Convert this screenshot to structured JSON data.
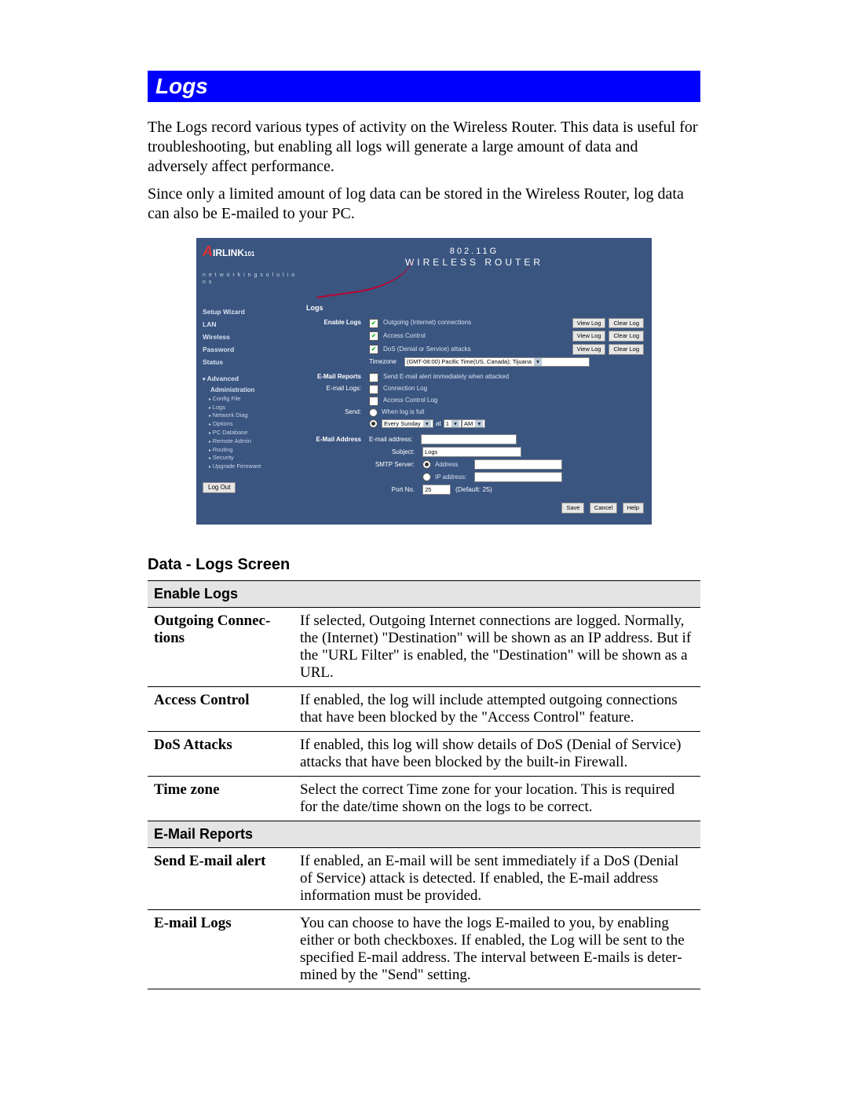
{
  "title": "Logs",
  "para1": "The Logs record various types of activity on the Wireless Router. This data is useful for troubleshooting, but enabling all logs will generate a large amount of data and adversely affect performance.",
  "para2": "Since only a limited amount of log data can be stored in the Wireless Router, log data can also be E-mailed to your PC.",
  "shot": {
    "brand": {
      "name": "IRLINK",
      "sub": "101",
      "tag": "n e t w o r k i n g s o l u t i o n s"
    },
    "header": {
      "t1": "802.11G",
      "t2": "WIRELESS ROUTER"
    },
    "nav": {
      "wizard": "Setup Wizard",
      "lan": "LAN",
      "wireless": "Wireless",
      "password": "Password",
      "status": "Status",
      "advanced": "Advanced",
      "administration": "Administration",
      "items": [
        "Config File",
        "Logs",
        "Network Diag",
        "Options",
        "PC Database",
        "Remote Admin",
        "Routing",
        "Security",
        "Upgrade Firmware"
      ],
      "logout": "Log Out"
    },
    "content": {
      "heading": "Logs",
      "enable_label": "Enable Logs",
      "logs": [
        {
          "label": "Outgoing (Internet) connections",
          "view": "View Log",
          "clear": "Clear Log"
        },
        {
          "label": "Access Control",
          "view": "View Log",
          "clear": "Clear Log"
        },
        {
          "label": "DoS (Denial or Service) attacks",
          "view": "View Log",
          "clear": "Clear Log"
        }
      ],
      "timezone_label": "Timezone",
      "timezone_value": "(GMT-08:00) Pacific Time(US, Canada); Tijuana",
      "reports_label": "E-Mail Reports",
      "send_alert": "Send E-mail alert immediately when attacked",
      "email_logs_label": "E-mail Logs:",
      "email_logs": [
        "Connection Log",
        "Access Control Log"
      ],
      "send_label": "Send:",
      "send_opt1": "When log is full",
      "send_opt2": "Every Sunday",
      "send_at": "at",
      "send_hour": "1",
      "send_ampm": "AM",
      "addr_section": "E-Mail Address",
      "email_addr": "E-mail address:",
      "subject_label": "Subject:",
      "subject_value": "Logs",
      "smtp_label": "SMTP Server:",
      "smtp_opt1": "Address",
      "smtp_opt2": "IP address:",
      "port_label": "Port No.",
      "port_value": "25",
      "port_default": "(Default: 25)",
      "buttons": {
        "save": "Save",
        "cancel": "Cancel",
        "help": "Help"
      }
    }
  },
  "data_heading": "Data - Logs Screen",
  "table": {
    "sec1": "Enable Logs",
    "rows1": [
      {
        "k": "Outgoing Connec­tions",
        "v": "If selected, Outgoing Internet connections are logged. Normally, the (Internet) \"Destination\" will be shown as an IP address. But if the \"URL Filter\" is enabled, the \"Destination\" will be shown as a URL."
      },
      {
        "k": "Access Control",
        "v": "If enabled, the log will include attempted outgoing connections that have been blocked by the \"Access Control\" feature."
      },
      {
        "k": "DoS Attacks",
        "v": "If enabled, this log will show details of DoS (Denial of Service) attacks that have been blocked by the built-in Firewall."
      },
      {
        "k": "Time zone",
        "v": "Select the correct Time zone for your location. This is required for the date/time shown on the logs to be correct."
      }
    ],
    "sec2": "E-Mail Reports",
    "rows2": [
      {
        "k": "Send E-mail alert",
        "v": "If enabled, an E-mail will be sent immediately if a DoS (Denial of Service) attack is detected. If enabled, the E-mail address infor­mation must be provided."
      },
      {
        "k": "E-mail Logs",
        "v": "You can choose to have the logs E-mailed to you, by enabling either or both checkboxes. If enabled, the Log will be sent to the specified E-mail address. The interval between E-mails is deter­mined by the \"Send\" setting."
      }
    ]
  }
}
